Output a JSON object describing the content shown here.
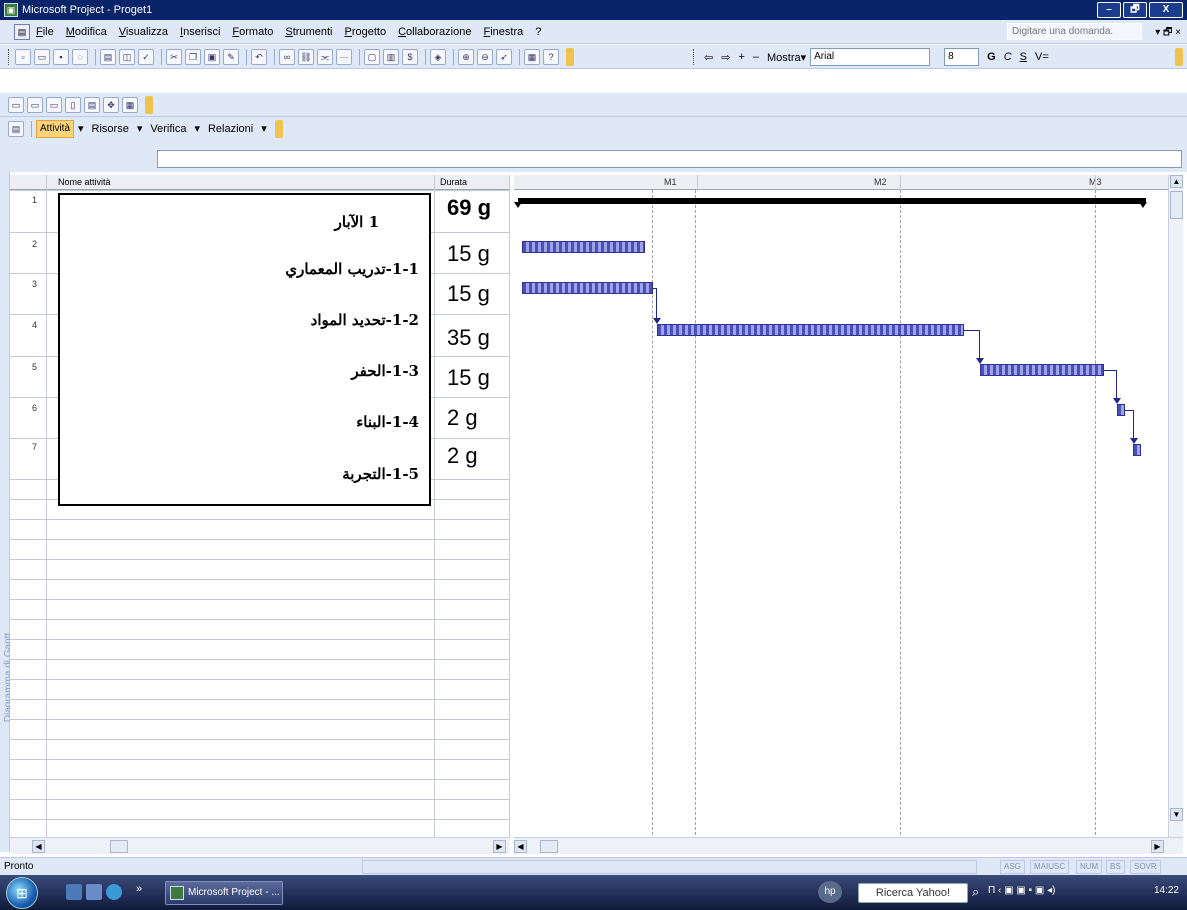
{
  "window": {
    "title": "Microsoft Project - Proget1",
    "controls": [
      "–",
      "🗗",
      "X"
    ]
  },
  "menubar": {
    "items": [
      "File",
      "Modifica",
      "Visualizza",
      "Inserisci",
      "Formato",
      "Strumenti",
      "Progetto",
      "Collaborazione",
      "Finestra",
      "?"
    ],
    "ask_placeholder": "Digitare una domanda.",
    "right_ctrl": "▾ 🗗 ×"
  },
  "format_toolbar": {
    "show_label": "Mostra▾",
    "font": "Arial",
    "size": "8",
    "bold": "G",
    "italic": "C",
    "underline": "S",
    "filter": "V="
  },
  "project_guide": {
    "items": [
      "Attività",
      "Risorse",
      "Verifica",
      "Relazioni"
    ]
  },
  "table": {
    "col_name": "Nome attività",
    "col_duration": "Durata",
    "row_numbers": [
      "1",
      "2",
      "3",
      "4",
      "5",
      "6",
      "7"
    ]
  },
  "overlay": {
    "lines": [
      "1      الآبار",
      "1-1-تدريب المعماري",
      "1-2-تحديد المواد",
      "1-3-الحفر",
      "1-4-البناء",
      "1-5-التجربة"
    ],
    "durations": [
      "69 g",
      "15 g",
      "15 g",
      "35 g",
      "15 g",
      "2 g",
      "2 g"
    ]
  },
  "gantt": {
    "timescale": [
      "M1",
      "M2",
      "M3"
    ]
  },
  "sidebar": {
    "view_label": "Diagramma di Gantt"
  },
  "statusbar": {
    "text": "Pronto",
    "indicators": [
      "ASG",
      "MAIUSC",
      "NUM",
      "BS",
      "SOVR"
    ]
  },
  "taskbar": {
    "task_label": "Microsoft Project - ...",
    "search_label": "Ricerca Yahoo!",
    "clock": "14:22",
    "chevron": "»"
  }
}
